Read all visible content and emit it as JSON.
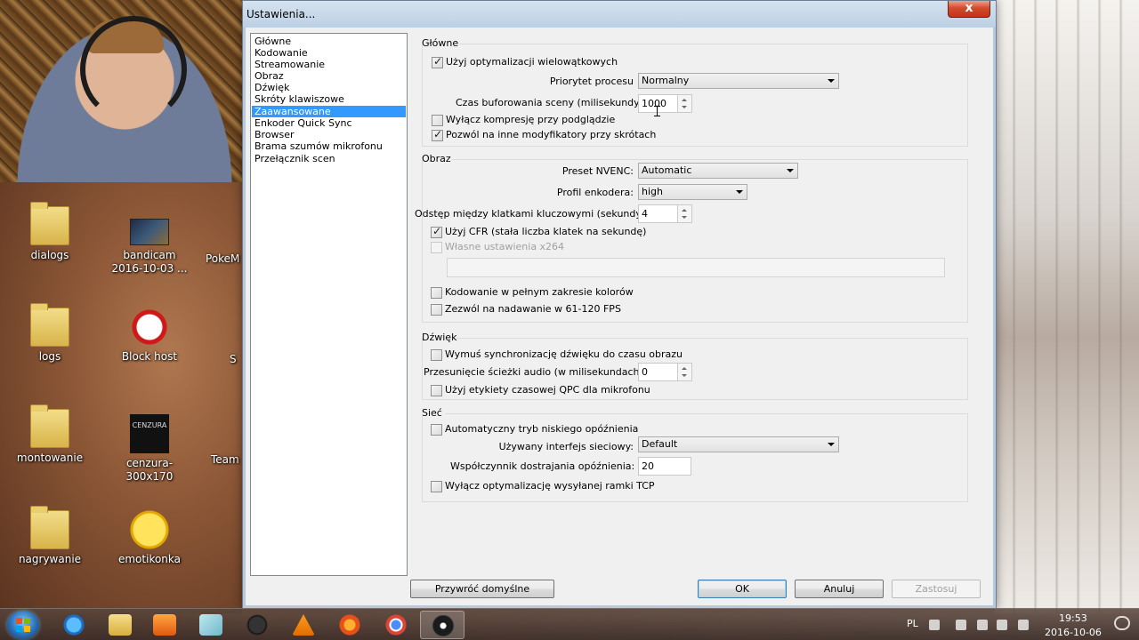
{
  "dialog": {
    "title": "Ustawienia...",
    "close_label": "x"
  },
  "nav": {
    "items": [
      {
        "label": "Główne"
      },
      {
        "label": "Kodowanie"
      },
      {
        "label": "Streamowanie"
      },
      {
        "label": "Obraz"
      },
      {
        "label": "Dźwięk"
      },
      {
        "label": "Skróty klawiszowe"
      },
      {
        "label": "Zaawansowane",
        "selected": true
      },
      {
        "label": "Enkoder Quick Sync"
      },
      {
        "label": "Browser"
      },
      {
        "label": "Brama szumów mikrofonu"
      },
      {
        "label": "Przełącznik scen"
      }
    ]
  },
  "general": {
    "title": "Główne",
    "multithread_label": "Użyj optymalizacji wielowątkowych",
    "multithread_checked": true,
    "priority_label": "Priorytet procesu",
    "priority_value": "Normalny",
    "buffer_label": "Czas buforowania sceny (milisekundy):",
    "buffer_value": "1000",
    "disable_preview_compression_label": "Wyłącz kompresję przy podglądzie",
    "disable_preview_compression_checked": false,
    "allow_modifiers_label": "Pozwól na inne modyfikatory przy skrótach",
    "allow_modifiers_checked": true
  },
  "video": {
    "title": "Obraz",
    "preset_label": "Preset NVENC:",
    "preset_value": "Automatic",
    "profile_label": "Profil enkodera:",
    "profile_value": "high",
    "keyframe_label": "Odstęp między klatkami kluczowymi (sekundy,",
    "keyframe_value": "4",
    "cfr_label": "Użyj CFR (stała liczba klatek na sekundę)",
    "cfr_checked": true,
    "custom_x264_label": "Własne ustawienia x264",
    "custom_x264_checked": false,
    "custom_x264_value": "",
    "full_range_label": "Kodowanie w pełnym zakresie kolorów",
    "full_range_checked": false,
    "high_fps_label": "Zezwól na nadawanie w 61-120 FPS",
    "high_fps_checked": false
  },
  "audio": {
    "title": "Dźwięk",
    "force_sync_label": "Wymuś synchronizację dźwięku do czasu obrazu",
    "force_sync_checked": false,
    "offset_label": "Przesunięcie ścieżki audio (w milisekundach):",
    "offset_value": "0",
    "qpc_label": "Użyj etykiety czasowej QPC dla mikrofonu",
    "qpc_checked": false
  },
  "network": {
    "title": "Sieć",
    "low_latency_label": "Automatyczny tryb niskiego opóźnienia",
    "low_latency_checked": false,
    "interface_label": "Używany interfejs sieciowy:",
    "interface_value": "Default",
    "latency_factor_label": "Współczynnik dostrajania opóźnienia:",
    "latency_factor_value": "20",
    "disable_tcp_label": "Wyłącz optymalizację wysyłanej ramki TCP",
    "disable_tcp_checked": false
  },
  "buttons": {
    "restore_defaults": "Przywróć domyślne",
    "ok": "OK",
    "cancel": "Anuluj",
    "apply": "Zastosuj"
  },
  "desktop_icons": [
    {
      "label": "dialogs",
      "icon": "folder-icon"
    },
    {
      "label": "bandicam 2016-10-03 ...",
      "icon": "video-thumbnail-icon"
    },
    {
      "label": "logs",
      "icon": "folder-icon"
    },
    {
      "label": "Block host",
      "icon": "block-host-icon"
    },
    {
      "label": "montowanie",
      "icon": "folder-icon"
    },
    {
      "label": "cenzura-300x170",
      "icon": "image-thumbnail-icon",
      "caption": "CENZURA"
    },
    {
      "label": "nagrywanie",
      "icon": "folder-icon"
    },
    {
      "label": "emotikonka",
      "icon": "emoticon-icon"
    }
  ],
  "desktop_partial_labels": [
    "PokeM",
    "S",
    "Team"
  ],
  "taskbar": {
    "apps": [
      "internet-explorer-icon",
      "file-explorer-icon",
      "media-player-icon",
      "notepad-icon",
      "app-icon",
      "vlc-icon",
      "firefox-icon",
      "chrome-icon",
      "obs-icon"
    ],
    "active_app": "obs-icon",
    "language": "PL",
    "time": "19:53",
    "date": "2016-10-06"
  }
}
